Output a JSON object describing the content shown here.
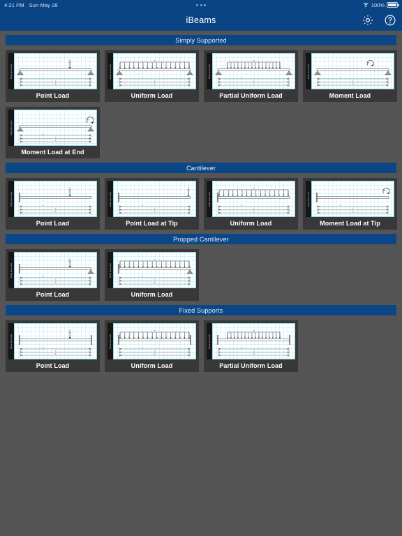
{
  "status_bar": {
    "time": "4:21 PM",
    "date": "Sun May 28",
    "battery_text": "100%",
    "wifi_icon": "wifi-icon",
    "battery_icon": "battery-full-icon",
    "multitask_indicator": "three-dots-icon"
  },
  "nav_bar": {
    "title": "iBeams",
    "settings_icon": "gear-icon",
    "help_icon": "question-mark-circle-icon"
  },
  "colors": {
    "nav_blue": "#0a4484",
    "section_blue": "#0b4686",
    "page_background": "#555555",
    "card_background": "#383838",
    "grid_cyan": "#b9eaf6",
    "label_white": "#ffffff"
  },
  "thumbnail_axis_label": "Beam and Loads",
  "sections": [
    {
      "title": "Simply Supported",
      "cards": [
        {
          "label": "Point Load",
          "support": "pinned-pinned",
          "load": "point"
        },
        {
          "label": "Uniform Load",
          "support": "pinned-pinned",
          "load": "uniform"
        },
        {
          "label": "Partial Uniform Load",
          "support": "pinned-pinned",
          "load": "partial-uniform"
        },
        {
          "label": "Moment Load",
          "support": "pinned-pinned",
          "load": "moment"
        },
        {
          "label": "Moment Load at End",
          "support": "pinned-pinned",
          "load": "moment-end"
        }
      ]
    },
    {
      "title": "Cantilever",
      "cards": [
        {
          "label": "Point Load",
          "support": "fixed-free",
          "load": "point"
        },
        {
          "label": "Point Load at Tip",
          "support": "fixed-free",
          "load": "point-tip"
        },
        {
          "label": "Uniform Load",
          "support": "fixed-free",
          "load": "uniform"
        },
        {
          "label": "Moment Load at Tip",
          "support": "fixed-free",
          "load": "moment-tip"
        }
      ]
    },
    {
      "title": "Propped Cantilever",
      "cards": [
        {
          "label": "Point Load",
          "support": "fixed-pinned",
          "load": "point"
        },
        {
          "label": "Uniform Load",
          "support": "fixed-pinned",
          "load": "uniform"
        }
      ]
    },
    {
      "title": "Fixed Supports",
      "cards": [
        {
          "label": "Point Load",
          "support": "fixed-fixed",
          "load": "point"
        },
        {
          "label": "Uniform Load",
          "support": "fixed-fixed",
          "load": "uniform"
        },
        {
          "label": "Partial Uniform Load",
          "support": "fixed-fixed",
          "load": "partial-uniform"
        }
      ]
    }
  ]
}
